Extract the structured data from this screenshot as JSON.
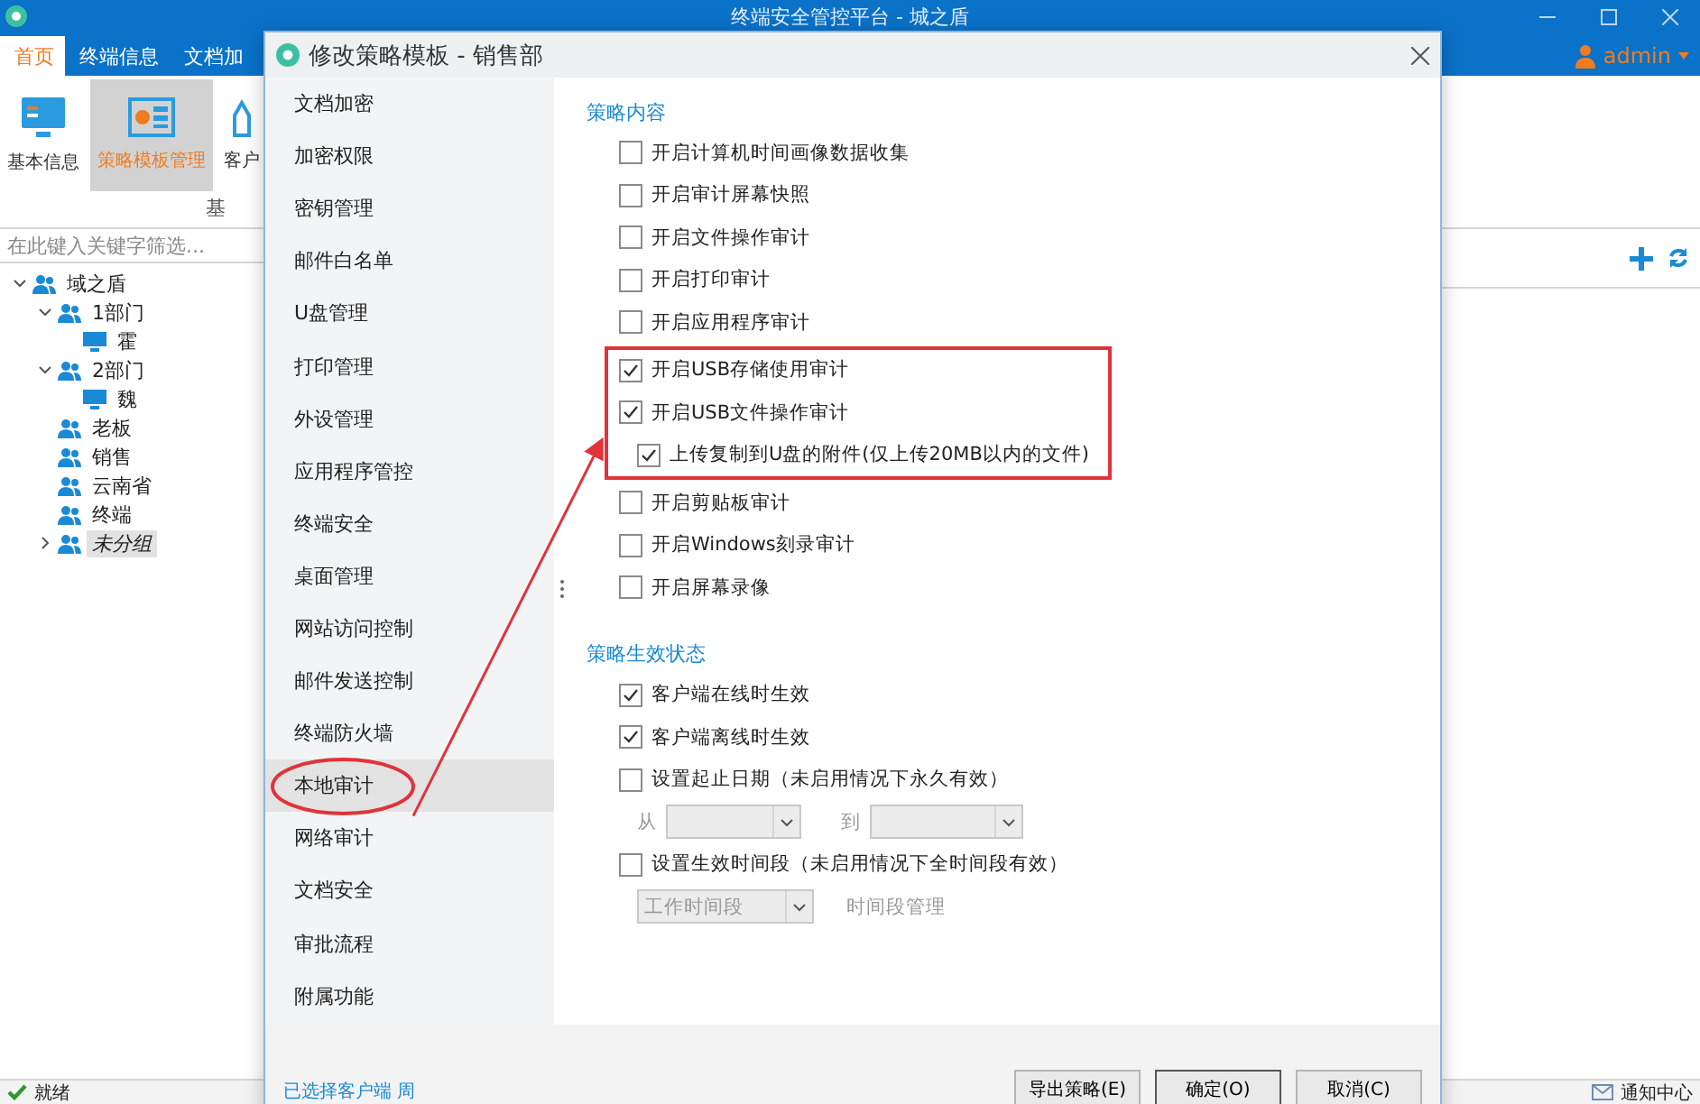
{
  "app": {
    "title": "终端安全管控平台 - 城之盾",
    "tabs": [
      {
        "label": "首页",
        "selected": true
      },
      {
        "label": "终端信息",
        "selected": false
      },
      {
        "label": "文档加",
        "selected": false
      }
    ],
    "user": "admin",
    "ribbon": {
      "buttons": [
        {
          "label": "基本信息",
          "selected": false,
          "kind": "monitor"
        },
        {
          "label": "策略模板管理",
          "selected": true,
          "kind": "card"
        },
        {
          "label": "客户",
          "selected": false,
          "kind": "other"
        }
      ],
      "group_label": "基"
    },
    "search": {
      "placeholder": "在此键入关键字筛选..."
    },
    "tree": [
      {
        "label": "域之盾",
        "kind": "group",
        "expanded": true,
        "selected": false,
        "children": [
          {
            "label": "1部门",
            "kind": "group",
            "expanded": true,
            "selected": false,
            "children": [
              {
                "label": "霍",
                "kind": "computer",
                "selected": false
              }
            ]
          },
          {
            "label": "2部门",
            "kind": "group",
            "expanded": true,
            "selected": false,
            "children": [
              {
                "label": "魏",
                "kind": "computer",
                "selected": false
              }
            ]
          },
          {
            "label": "老板",
            "kind": "group",
            "selected": false
          },
          {
            "label": "销售",
            "kind": "group",
            "selected": false
          },
          {
            "label": "云南省",
            "kind": "group",
            "selected": false
          },
          {
            "label": "终端",
            "kind": "group",
            "selected": false
          },
          {
            "label": "未分组",
            "kind": "group",
            "expanded": false,
            "selected": true
          }
        ]
      }
    ],
    "status_bar": {
      "text": "就绪",
      "notification": "通知中心"
    }
  },
  "dialog": {
    "title": "修改策略模板 - 销售部",
    "nav": [
      {
        "label": "文档加密",
        "selected": false,
        "circled": false
      },
      {
        "label": "加密权限",
        "selected": false,
        "circled": false
      },
      {
        "label": "密钥管理",
        "selected": false,
        "circled": false
      },
      {
        "label": "邮件白名单",
        "selected": false,
        "circled": false
      },
      {
        "label": "U盘管理",
        "selected": false,
        "circled": false
      },
      {
        "label": "打印管理",
        "selected": false,
        "circled": false
      },
      {
        "label": "外设管理",
        "selected": false,
        "circled": false
      },
      {
        "label": "应用程序管控",
        "selected": false,
        "circled": false
      },
      {
        "label": "终端安全",
        "selected": false,
        "circled": false
      },
      {
        "label": "桌面管理",
        "selected": false,
        "circled": false
      },
      {
        "label": "网站访问控制",
        "selected": false,
        "circled": false
      },
      {
        "label": "邮件发送控制",
        "selected": false,
        "circled": false
      },
      {
        "label": "终端防火墙",
        "selected": false,
        "circled": false
      },
      {
        "label": "本地审计",
        "selected": true,
        "circled": true
      },
      {
        "label": "网络审计",
        "selected": false,
        "circled": false
      },
      {
        "label": "文档安全",
        "selected": false,
        "circled": false
      },
      {
        "label": "审批流程",
        "selected": false,
        "circled": false
      },
      {
        "label": "附属功能",
        "selected": false,
        "circled": false
      }
    ],
    "sections": [
      {
        "title": "策略内容",
        "items": [
          {
            "kind": "checkbox",
            "label": "开启计算机时间画像数据收集",
            "checked": false
          },
          {
            "kind": "checkbox",
            "label": "开启审计屏幕快照",
            "checked": false
          },
          {
            "kind": "checkbox",
            "label": "开启文件操作审计",
            "checked": false
          },
          {
            "kind": "checkbox",
            "label": "开启打印审计",
            "checked": false
          },
          {
            "kind": "checkbox",
            "label": "开启应用程序审计",
            "checked": false
          },
          {
            "kind": "highlight",
            "items": [
              {
                "kind": "checkbox",
                "label": "开启USB存储使用审计",
                "checked": true
              },
              {
                "kind": "checkbox",
                "label": "开启USB文件操作审计",
                "checked": true,
                "children": [
                  {
                    "kind": "checkbox",
                    "label": "上传复制到U盘的附件(仅上传20MB以内的文件)",
                    "checked": true
                  }
                ]
              }
            ]
          },
          {
            "kind": "checkbox",
            "label": "开启剪贴板审计",
            "checked": false
          },
          {
            "kind": "checkbox",
            "label": "开启Windows刻录审计",
            "checked": false
          },
          {
            "kind": "checkbox",
            "label": "开启屏幕录像",
            "checked": false
          }
        ]
      },
      {
        "title": "策略生效状态",
        "items": [
          {
            "kind": "checkbox",
            "label": "客户端在线时生效",
            "checked": true
          },
          {
            "kind": "checkbox",
            "label": "客户端离线时生效",
            "checked": true
          },
          {
            "kind": "checkbox",
            "label": "设置起止日期（未启用情况下永久有效）",
            "checked": false
          },
          {
            "kind": "date_range",
            "from_label": "从",
            "to_label": "到",
            "disabled": true
          },
          {
            "kind": "checkbox",
            "label": "设置生效时间段（未启用情况下全时间段有效）",
            "checked": false
          },
          {
            "kind": "select_row",
            "value": "工作时间段",
            "link": "时间段管理",
            "disabled": true
          }
        ]
      }
    ],
    "selection_info": "已选择客户端 周",
    "buttons": [
      {
        "label": "导出策略(E)",
        "default": false
      },
      {
        "label": "确定(O)",
        "default": true
      },
      {
        "label": "取消(C)",
        "default": false
      }
    ]
  }
}
